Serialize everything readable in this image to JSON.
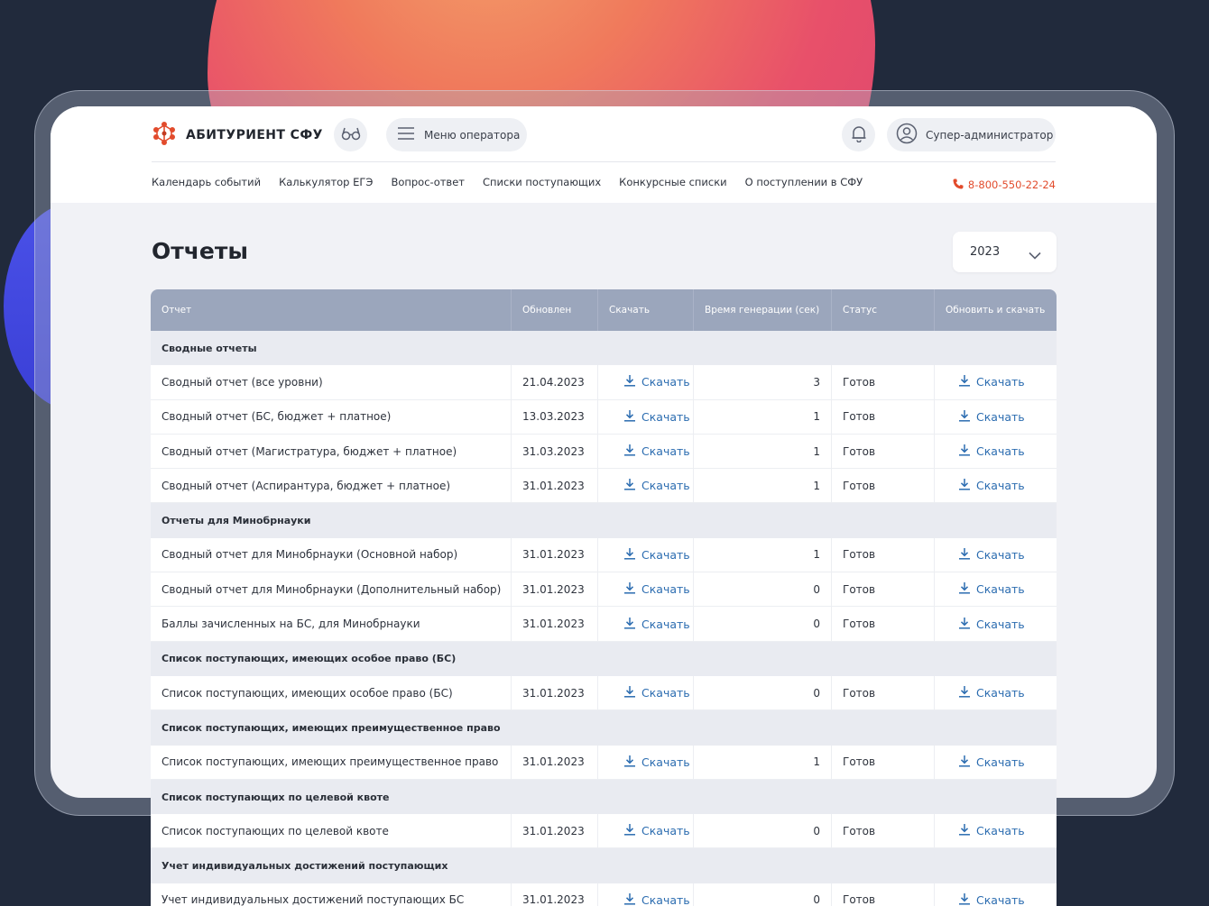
{
  "header": {
    "logo_text": "АБИТУРИЕНТ СФУ",
    "menu_label": "Меню оператора",
    "user_label": "Супер-администратор",
    "phone": "8-800-550-22-24",
    "nav": [
      "Календарь событий",
      "Калькулятор ЕГЭ",
      "Вопрос-ответ",
      "Списки поступающих",
      "Конкурсные списки",
      "О поступлении в СФУ"
    ]
  },
  "page": {
    "title": "Отчеты",
    "year_select": "2023"
  },
  "table": {
    "columns": [
      "Отчет",
      "Обновлен",
      "Скачать",
      "Время генерации (сек)",
      "Статус",
      "Обновить и скачать"
    ],
    "download_label": "Скачать",
    "groups": [
      {
        "title": "Сводные отчеты",
        "rows": [
          {
            "name": "Сводный отчет (все уровни)",
            "updated": "21.04.2023",
            "time": "3",
            "status": "Готов"
          },
          {
            "name": "Сводный отчет (БС, бюджет + платное)",
            "updated": "13.03.2023",
            "time": "1",
            "status": "Готов"
          },
          {
            "name": "Сводный отчет (Магистратура, бюджет + платное)",
            "updated": "31.03.2023",
            "time": "1",
            "status": "Готов"
          },
          {
            "name": "Сводный отчет (Аспирантура, бюджет + платное)",
            "updated": "31.01.2023",
            "time": "1",
            "status": "Готов"
          }
        ]
      },
      {
        "title": "Отчеты для Минобрнауки",
        "rows": [
          {
            "name": "Сводный отчет для Минобрнауки (Основной набор)",
            "updated": "31.01.2023",
            "time": "1",
            "status": "Готов"
          },
          {
            "name": "Сводный отчет для Минобрнауки (Дополнительный набор)",
            "updated": "31.01.2023",
            "time": "0",
            "status": "Готов"
          },
          {
            "name": "Баллы зачисленных на БС, для Минобрнауки",
            "updated": "31.01.2023",
            "time": "0",
            "status": "Готов"
          }
        ]
      },
      {
        "title": "Список поступающих, имеющих особое право (БС)",
        "rows": [
          {
            "name": "Список поступающих, имеющих особое право (БС)",
            "updated": "31.01.2023",
            "time": "0",
            "status": "Готов"
          }
        ]
      },
      {
        "title": "Список поступающих, имеющих преимущественное право",
        "rows": [
          {
            "name": "Список поступающих, имеющих преимущественное право",
            "updated": "31.01.2023",
            "time": "1",
            "status": "Готов"
          }
        ]
      },
      {
        "title": "Список поступающих по целевой квоте",
        "rows": [
          {
            "name": "Список поступающих по целевой квоте",
            "updated": "31.01.2023",
            "time": "0",
            "status": "Готов"
          }
        ]
      },
      {
        "title": "Учет индивидуальных достижений поступающих",
        "rows": [
          {
            "name": "Учет индивидуальных достижений поступающих БС",
            "updated": "31.01.2023",
            "time": "0",
            "status": "Готов"
          }
        ]
      }
    ]
  },
  "colors": {
    "accent": "#e24b2c",
    "link": "#2b6cb0",
    "table_header": "#9ba6bc",
    "background": "#212a3c",
    "blob_warm": "#e8506a",
    "blob_blue": "#4a51e8"
  },
  "icons": {
    "logo": "molecule-logo-icon",
    "glasses": "glasses-icon",
    "menu": "hamburger-icon",
    "bell": "bell-icon",
    "user": "user-circle-icon",
    "phone": "phone-icon",
    "chevron": "chevron-down-icon",
    "download": "download-icon"
  }
}
